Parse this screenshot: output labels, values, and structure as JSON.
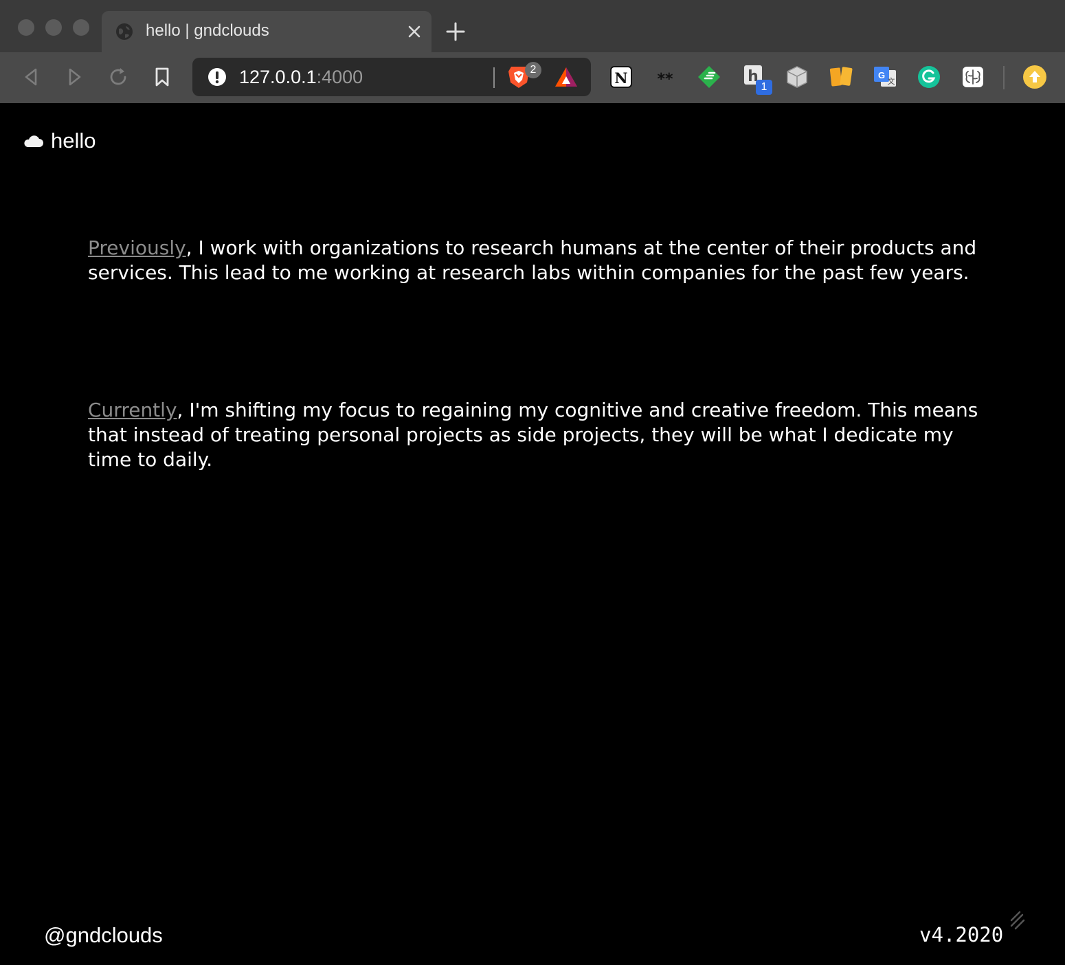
{
  "browser": {
    "tab": {
      "title": "hello | gndclouds",
      "favicon": "globe-icon",
      "close": "close-icon"
    },
    "new_tab": "plus-icon",
    "nav": [
      "back-icon",
      "forward-icon",
      "reload-icon",
      "bookmark-icon"
    ],
    "url": {
      "security": "not-secure-icon",
      "host": "127.0.0.1",
      "port": ":4000"
    },
    "brave_shields_count": "2",
    "extensions": [
      "notion-icon",
      "asterisks-icon",
      "feedly-icon",
      "hypothesis-icon",
      "cube-icon",
      "cards-icon",
      "google-translate-icon",
      "grammarly-icon",
      "brain-icon"
    ],
    "hypothesis_badge": "1",
    "profile": "update-avatar-icon"
  },
  "colors": {
    "page_bg": "#000000",
    "link": "#8c8c8c",
    "chrome_bg": "#3c3c3c",
    "brave_orange": "#fb542b"
  },
  "site": {
    "title": "hello",
    "logo": "cloud-icon",
    "paragraphs": [
      {
        "link": "Previously",
        "text": ", I work with organizations to research humans at the center of their products and services. This lead to me working at research labs within companies for the past few years."
      },
      {
        "link": "Currently",
        "text": ", I'm shifting my focus to regaining my cognitive and creative freedom. This means that instead of treating personal projects as side projects, they will be what I dedicate my time to daily."
      }
    ],
    "footer": {
      "handle": "@gndclouds",
      "version": "v4.2020"
    }
  }
}
